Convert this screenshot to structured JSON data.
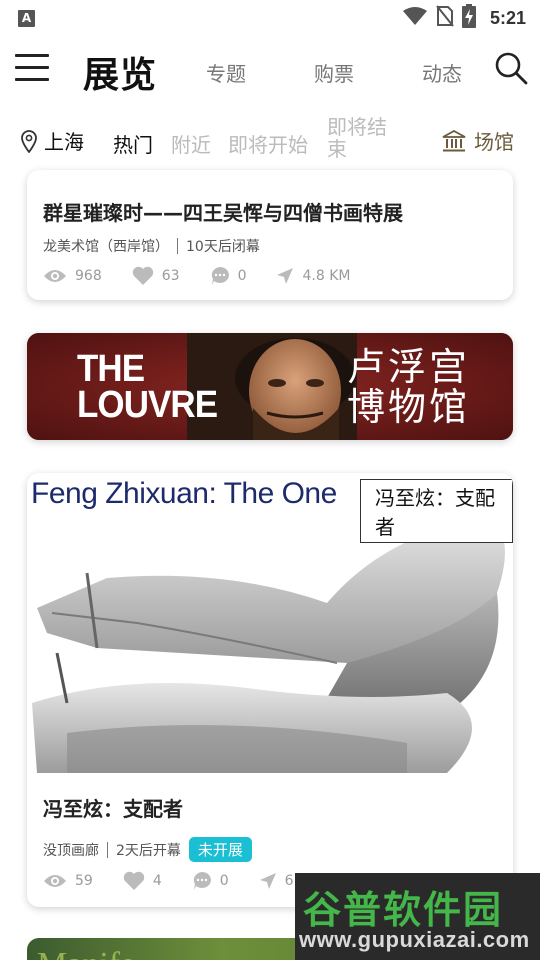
{
  "status_bar": {
    "left_icon": "A",
    "icons": [
      "wifi-icon",
      "no-sim-icon",
      "battery-charging-icon"
    ],
    "time": "5:21"
  },
  "header": {
    "title": "展览",
    "tabs": [
      {
        "label": "专题"
      },
      {
        "label": "购票"
      },
      {
        "label": "动态"
      }
    ]
  },
  "filters": {
    "location": "上海",
    "items": [
      {
        "label": "热门",
        "active": true
      },
      {
        "label": "附近",
        "active": false
      },
      {
        "label": "即将开始",
        "active": false
      },
      {
        "label": "即将结束",
        "active": false
      }
    ],
    "venue": "场馆"
  },
  "cards": [
    {
      "title": "群星璀璨时——四王吴恽与四僧书画特展",
      "venue": "龙美术馆（西岸馆）",
      "status_text": "10天后闭幕",
      "views": "968",
      "likes": "63",
      "comments": "0",
      "distance": "4.8 KM"
    },
    {
      "image_title_en": "Feng Zhixuan: The One",
      "image_title_zh": "冯至炫：支配者",
      "title": "冯至炫：支配者",
      "venue": "没顶画廊",
      "status_text": "2天后开幕",
      "badge": "未开展",
      "views": "59",
      "likes": "4",
      "comments": "0",
      "distance": "6.2 KM"
    }
  ],
  "banner": {
    "en_line1": "THE",
    "en_line2": "LOUVRE",
    "zh_line1": "卢浮宫",
    "zh_line2": "博物馆"
  },
  "next_card_peek": "Manife",
  "watermark": {
    "top": "谷普软件园",
    "bottom": "www.gupuxiazai.com"
  },
  "colors": {
    "badge": "#1bbfd3",
    "venue_accent": "#6b5a3b",
    "banner_bg": "#6b1a18",
    "watermark_green": "#45b649"
  }
}
